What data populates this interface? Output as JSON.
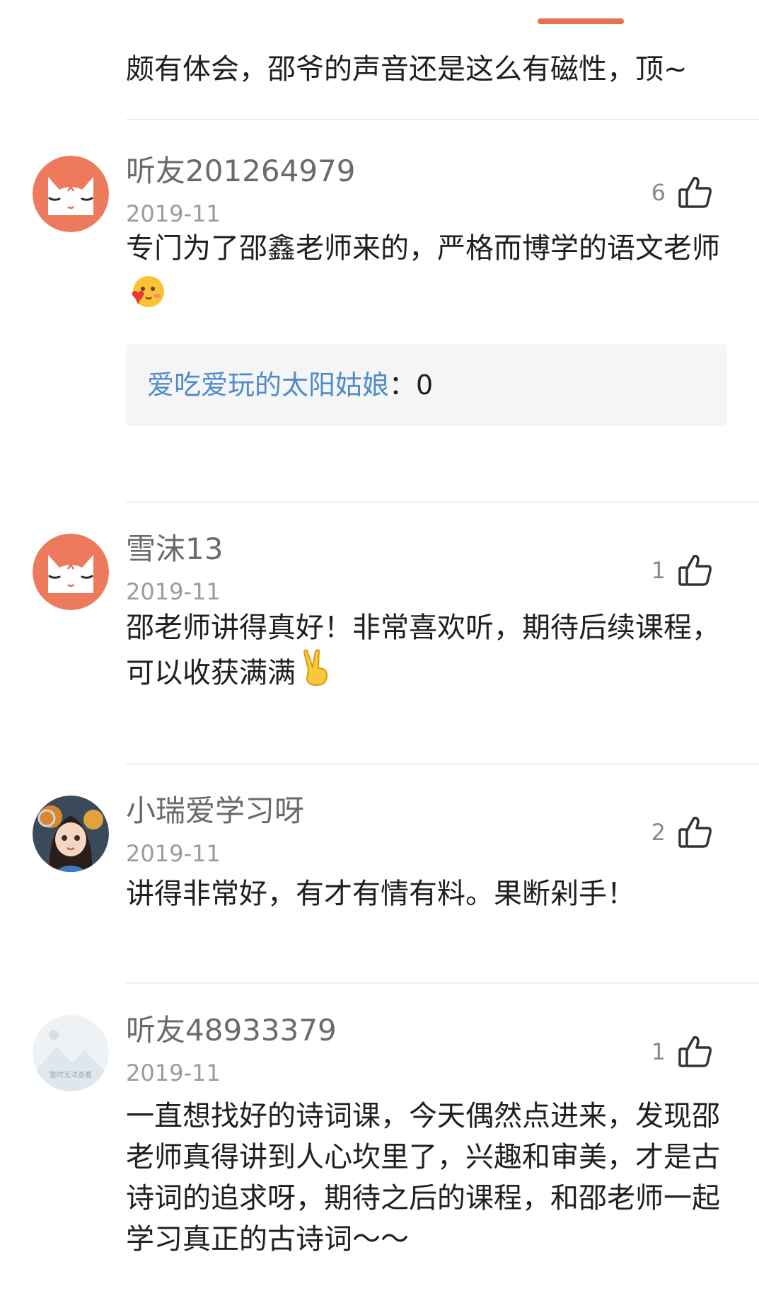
{
  "top_comment": {
    "text": "颇有体会，邵爷的声音还是这么有磁性，顶~"
  },
  "comments": [
    {
      "username": "听友201264979",
      "date": "2019-11",
      "likes": "6",
      "avatar": "cat-avatar",
      "text": "专门为了邵鑫老师来的，严格而博学的语文老师",
      "emoji": "heart-face-emoji",
      "reply": {
        "user": "爱吃爱玩的太阳姑娘",
        "separator": "：",
        "value": "0"
      }
    },
    {
      "username": "雪沫13",
      "date": "2019-11",
      "likes": "1",
      "avatar": "cat-avatar",
      "text": "邵老师讲得真好！非常喜欢听，期待后续课程，可以收获满满",
      "emoji": "victory-hand-emoji"
    },
    {
      "username": "小瑞爱学习呀",
      "date": "2019-11",
      "likes": "2",
      "avatar": "girl-avatar",
      "text": "讲得非常好，有才有情有料。果断剁手！"
    },
    {
      "username": "听友48933379",
      "date": "2019-11",
      "likes": "1",
      "avatar": "placeholder-avatar",
      "avatar_caption": "暂时无法查看",
      "text": "一直想找好的诗词课，今天偶然点进来，发现邵老师真得讲到人心坎里了，兴趣和审美，才是古诗词的追求呀，期待之后的课程，和邵老师一起学习真正的古诗词～～"
    }
  ],
  "colors": {
    "accent": "#e8704e",
    "username": "#6a6a6a",
    "date": "#9b9b9b",
    "reply_user": "#4f8ccb",
    "reply_bg": "#f5f5f5",
    "divider": "#eeeeee"
  }
}
